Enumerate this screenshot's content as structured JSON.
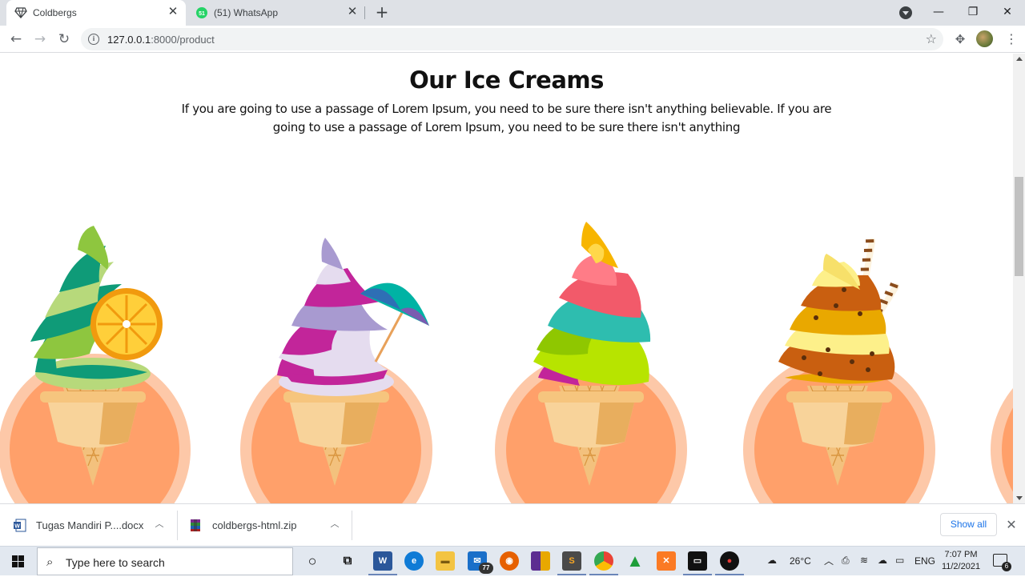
{
  "browser": {
    "tabs": [
      {
        "title": "Coldbergs",
        "active": true,
        "icon": "diamond-icon"
      },
      {
        "title": "(51) WhatsApp",
        "active": false,
        "icon": "whatsapp-icon",
        "badge": "51"
      }
    ],
    "new_tab": "+",
    "window": {
      "minimize": "—",
      "maximize": "❐",
      "close": "✕"
    },
    "url_host": "127.0.0.1",
    "url_path": ":8000/product"
  },
  "page": {
    "heading": "Our Ice Creams",
    "description": "If you are going to use a passage of Lorem Ipsum, you need to be sure there isn't anything believable. If you are going to use a passage of Lorem Ipsum, you need to be sure there isn't anything",
    "products": [
      {
        "topping": "orange-slice",
        "colors": [
          "#8ec63f",
          "#0f9b78",
          "#b7d97b"
        ]
      },
      {
        "topping": "umbrella",
        "colors": [
          "#c2259a",
          "#e5dcef",
          "#a89ad0"
        ]
      },
      {
        "topping": "banana-leaf",
        "colors": [
          "#f25a6a",
          "#2ebdaf",
          "#b7e400"
        ]
      },
      {
        "topping": "wafer-sticks",
        "colors": [
          "#e9a800",
          "#c95f10",
          "#fdf08a"
        ]
      }
    ]
  },
  "downloads": {
    "items": [
      {
        "name": "Tugas  Mandiri P....docx",
        "icon": "word-doc-icon"
      },
      {
        "name": "coldbergs-html.zip",
        "icon": "winrar-icon"
      }
    ],
    "show_all": "Show all"
  },
  "taskbar": {
    "search_placeholder": "Type here to search",
    "mail_badge": "77",
    "weather": "26°C",
    "language": "ENG",
    "time": "7:07 PM",
    "date": "11/2/2021",
    "notifications": "6"
  }
}
